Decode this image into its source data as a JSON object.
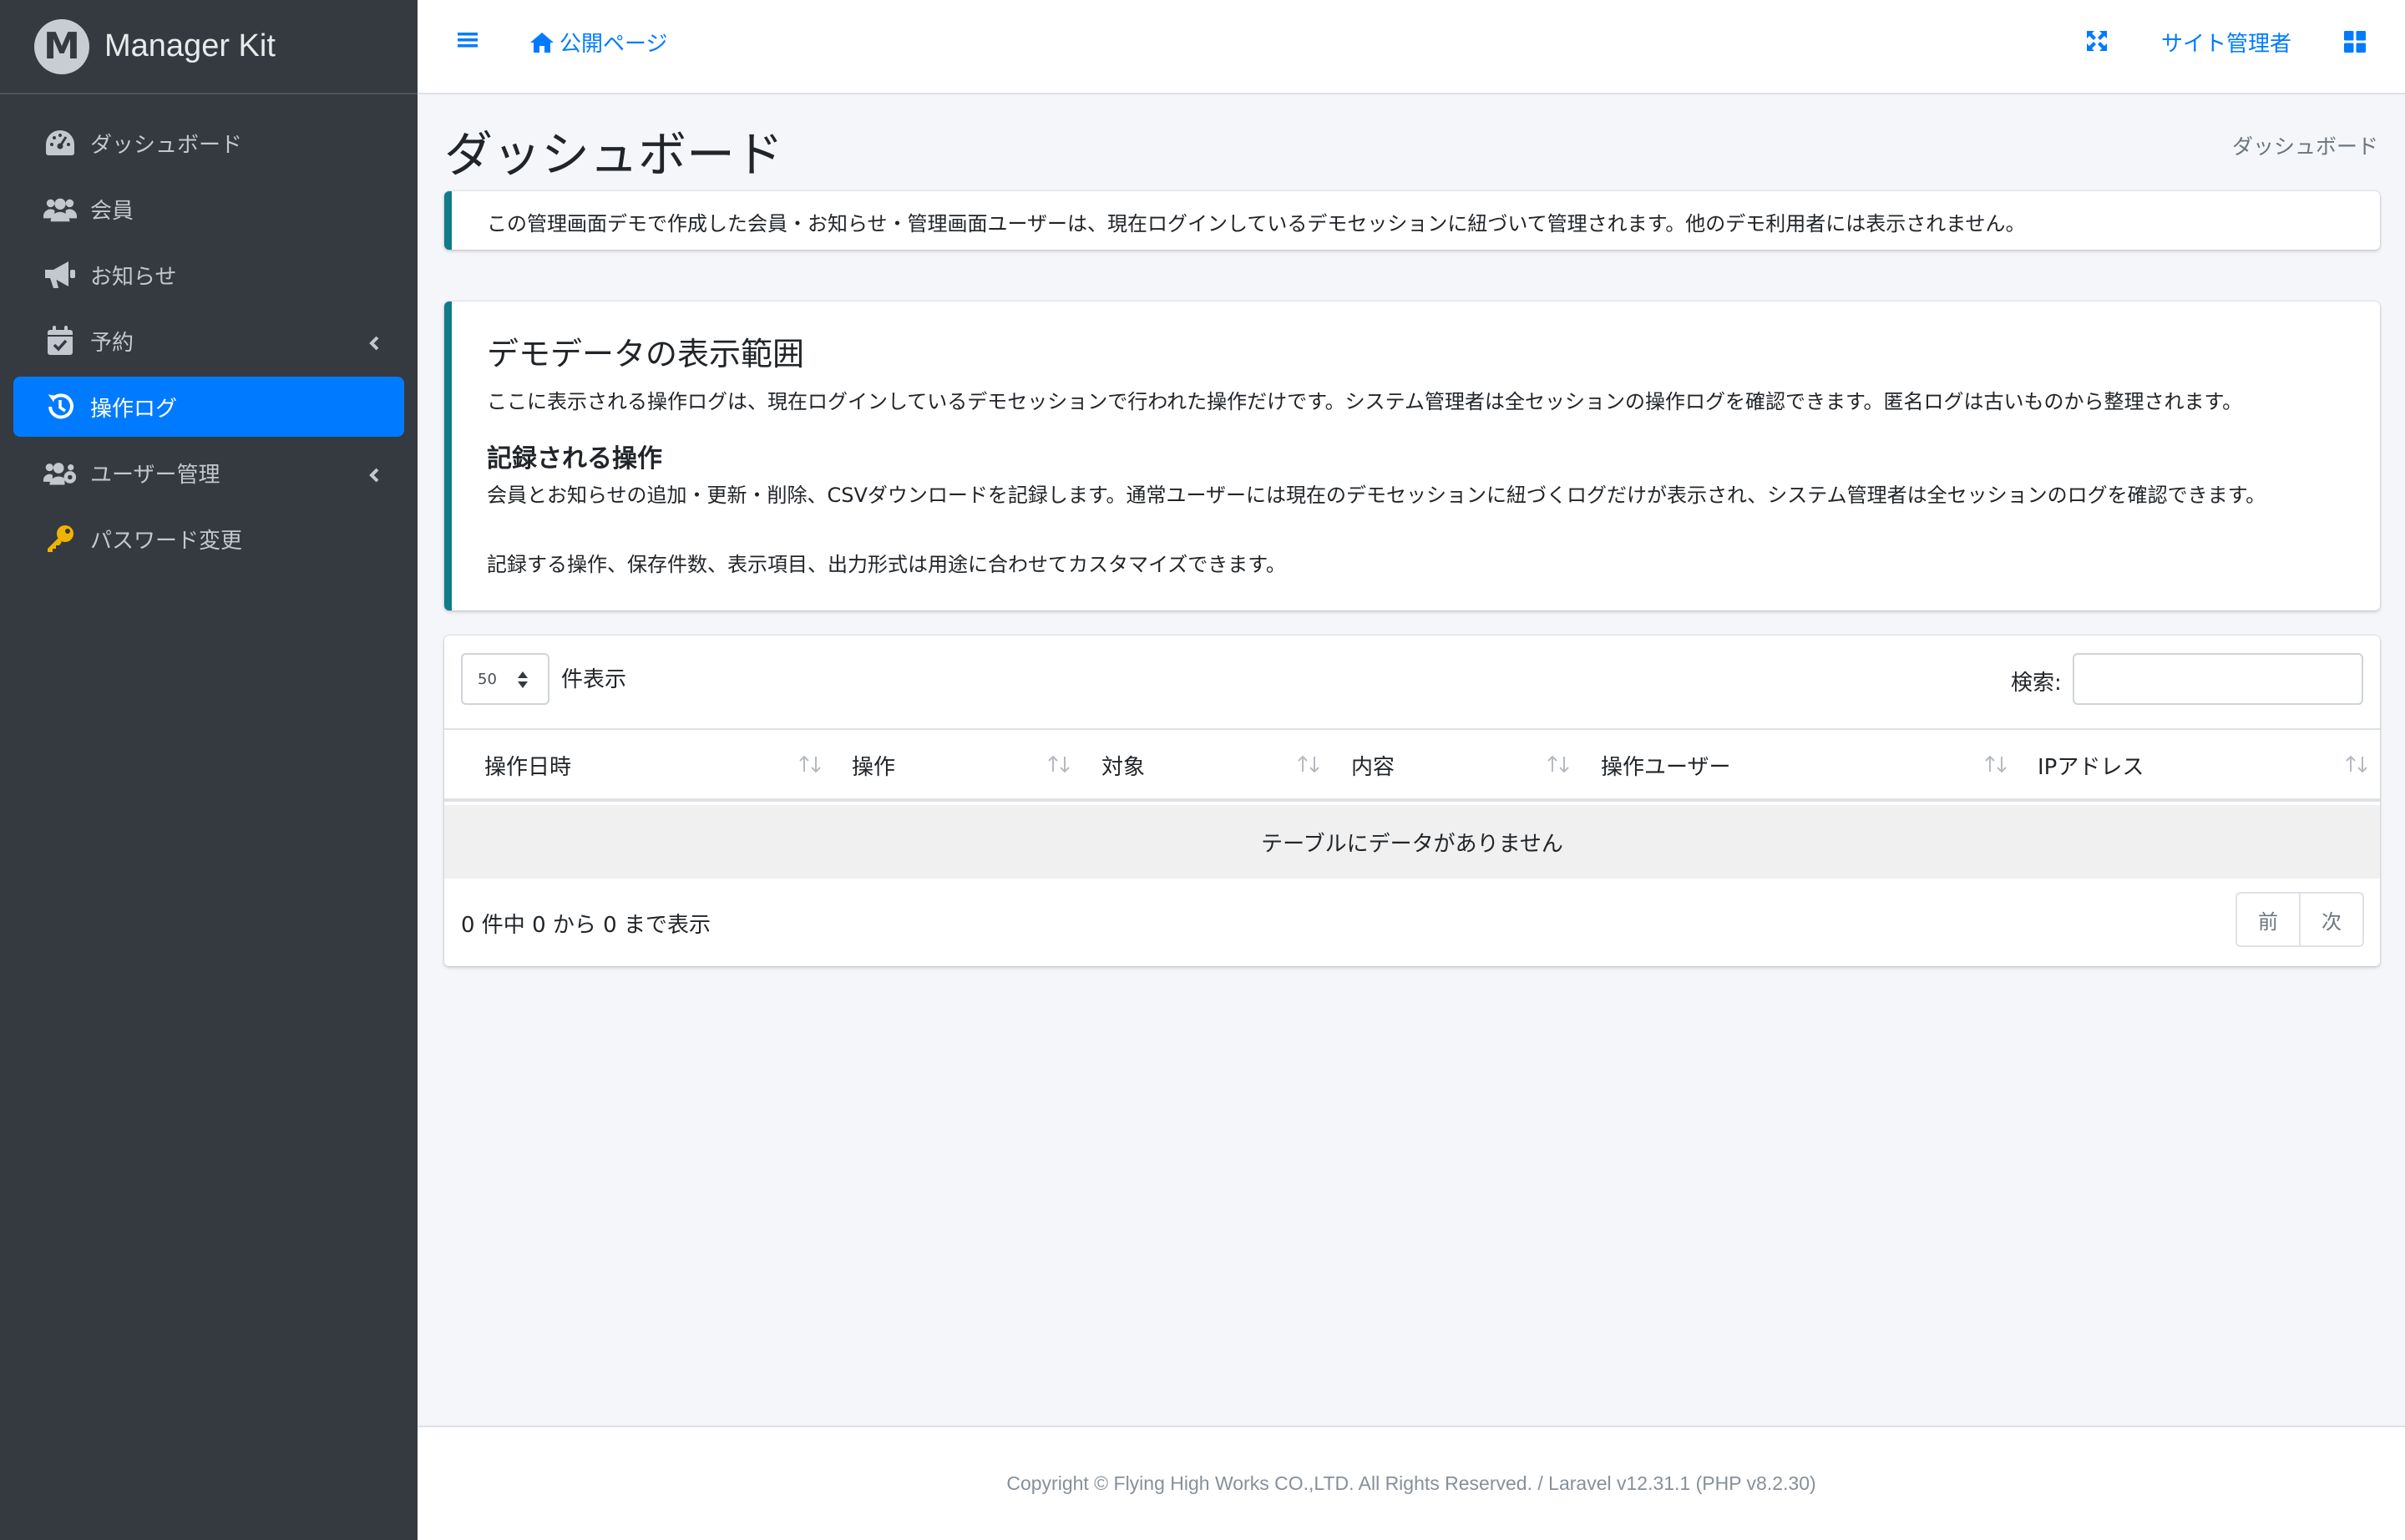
{
  "brand": {
    "logo_letter": "M",
    "name": "Manager Kit"
  },
  "sidebar": {
    "items": [
      {
        "label": "ダッシュボード",
        "icon": "tachometer-icon"
      },
      {
        "label": "会員",
        "icon": "users-icon"
      },
      {
        "label": "お知らせ",
        "icon": "bullhorn-icon"
      },
      {
        "label": "予約",
        "icon": "calendar-check-icon",
        "has_submenu": true
      },
      {
        "label": "操作ログ",
        "icon": "history-icon",
        "active": true
      },
      {
        "label": "ユーザー管理",
        "icon": "users-cog-icon",
        "has_submenu": true
      },
      {
        "label": "パスワード変更",
        "icon": "key-icon"
      }
    ]
  },
  "header": {
    "public_page": "公開ページ",
    "site_admin": "サイト管理者"
  },
  "page": {
    "title": "ダッシュボード",
    "breadcrumb": "ダッシュボード"
  },
  "notice": {
    "text": "この管理画面デモで作成した会員・お知らせ・管理画面ユーザーは、現在ログインしているデモセッションに紐づいて管理されます。他のデモ利用者には表示されません。"
  },
  "info": {
    "title": "デモデータの表示範囲",
    "p1": "ここに表示される操作ログは、現在ログインしているデモセッションで行われた操作だけです。システム管理者は全セッションの操作ログを確認できます。匿名ログは古いものから整理されます。",
    "subtitle": "記録される操作",
    "p2": "会員とお知らせの追加・更新・削除、CSVダウンロードを記録します。通常ユーザーには現在のデモセッションに紐づくログだけが表示され、システム管理者は全セッションのログを確認できます。",
    "p3": "記録する操作、保存件数、表示項目、出力形式は用途に合わせてカスタマイズできます。"
  },
  "table": {
    "length_value": "50",
    "length_label": "件表示",
    "search_label": "検索:",
    "search_value": "",
    "columns": [
      "操作日時",
      "操作",
      "対象",
      "内容",
      "操作ユーザー",
      "IPアドレス"
    ],
    "empty_text": "テーブルにデータがありません",
    "info_text": "0 件中 0 から 0 まで表示",
    "prev": "前",
    "next": "次"
  },
  "footer": {
    "text": "Copyright © Flying High Works CO.,LTD. All Rights Reserved. / Laravel v12.31.1 (PHP v8.2.30)"
  },
  "colors": {
    "sidebar_bg": "#343a40",
    "accent": "#007bff",
    "callout_border": "#117a8b",
    "key_icon": "#f0b400"
  }
}
